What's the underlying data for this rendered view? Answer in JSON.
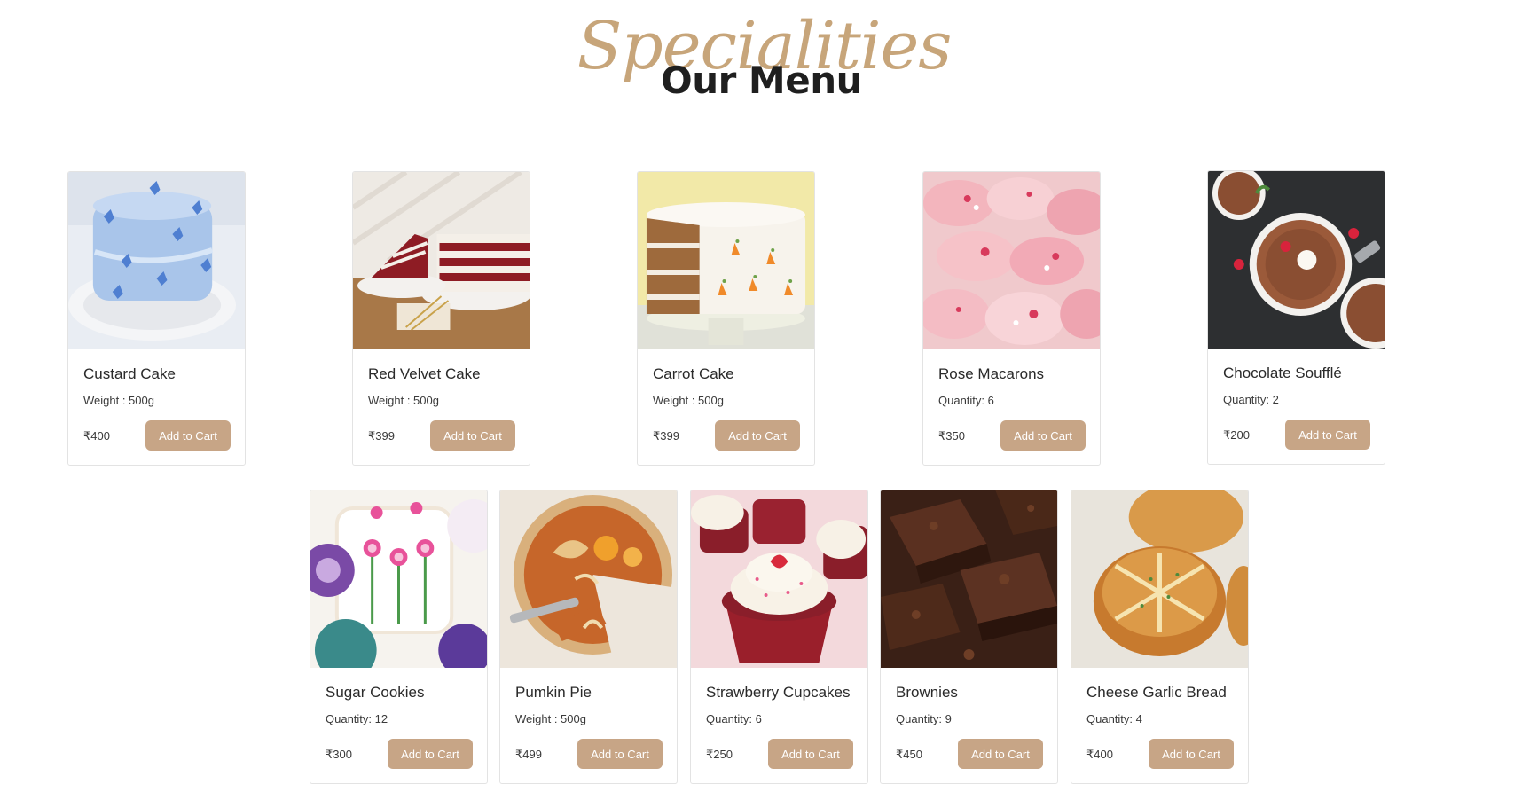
{
  "header": {
    "script_title": "Specialities",
    "title": "Our Menu"
  },
  "colors": {
    "accent": "#c7a586",
    "script": "#c7a57a"
  },
  "products": [
    {
      "name": "Custard Cake",
      "meta": "Weight : 500g",
      "price": "₹400",
      "button": "Add to Cart",
      "image": "blue-butterfly-cake"
    },
    {
      "name": "Red Velvet Cake",
      "meta": "Weight : 500g",
      "price": "₹399",
      "button": "Add to Cart",
      "image": "red-velvet-cake-slice"
    },
    {
      "name": "Carrot Cake",
      "meta": "Weight : 500g",
      "price": "₹399",
      "button": "Add to Cart",
      "image": "carrot-cake-on-stand"
    },
    {
      "name": "Rose Macarons",
      "meta": "Quantity: 6",
      "price": "₹350",
      "button": "Add to Cart",
      "image": "pink-macarons"
    },
    {
      "name": "Chocolate Soufflé",
      "meta": "Quantity: 2",
      "price": "₹200",
      "button": "Add to Cart",
      "image": "chocolate-souffle-ramekins"
    },
    {
      "name": "Sugar Cookies",
      "meta": "Quantity: 12",
      "price": "₹300",
      "button": "Add to Cart",
      "image": "decorated-sugar-cookies"
    },
    {
      "name": "Pumkin Pie",
      "meta": "Weight : 500g",
      "price": "₹499",
      "button": "Add to Cart",
      "image": "pumpkin-pie"
    },
    {
      "name": "Strawberry Cupcakes",
      "meta": "Quantity: 6",
      "price": "₹250",
      "button": "Add to Cart",
      "image": "red-velvet-cupcakes"
    },
    {
      "name": "Brownies",
      "meta": "Quantity: 9",
      "price": "₹450",
      "button": "Add to Cart",
      "image": "chocolate-brownies"
    },
    {
      "name": "Cheese Garlic Bread",
      "meta": "Quantity: 4",
      "price": "₹400",
      "button": "Add to Cart",
      "image": "garlic-bread-rolls"
    }
  ]
}
